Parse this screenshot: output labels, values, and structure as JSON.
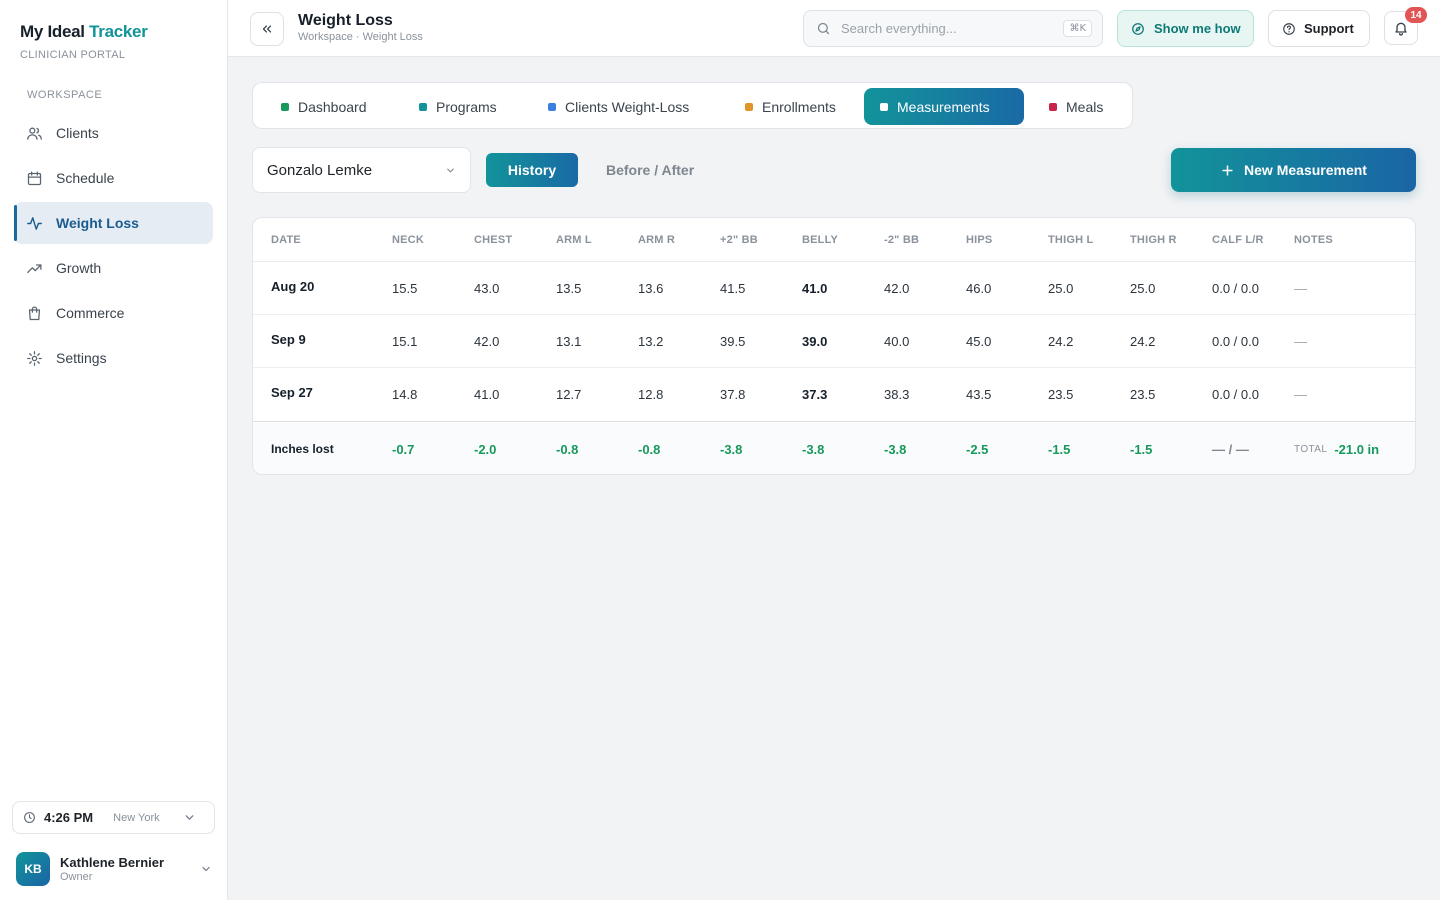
{
  "brand": {
    "name_part1": "My Ideal",
    "name_part2": "Tracker",
    "subtitle": "CLINICIAN PORTAL"
  },
  "sidebar": {
    "section_label": "WORKSPACE",
    "items": [
      {
        "label": "Clients",
        "icon": "users-icon"
      },
      {
        "label": "Schedule",
        "icon": "calendar-icon"
      },
      {
        "label": "Weight Loss",
        "icon": "activity-icon",
        "active": true
      },
      {
        "label": "Growth",
        "icon": "trending-up-icon"
      },
      {
        "label": "Commerce",
        "icon": "shopping-bag-icon"
      },
      {
        "label": "Settings",
        "icon": "gear-icon"
      }
    ],
    "clock": {
      "time": "4:26 PM",
      "timezone": "New York"
    },
    "user": {
      "initials": "KB",
      "name": "Kathlene Bernier",
      "role": "Owner"
    }
  },
  "topbar": {
    "title": "Weight Loss",
    "breadcrumb": "Workspace · Weight Loss",
    "search_placeholder": "Search everything...",
    "search_shortcut": "⌘K",
    "show_me_how": "Show me how",
    "support": "Support",
    "notifications_count": "14"
  },
  "tabs": [
    {
      "label": "Dashboard",
      "color": "#17995c"
    },
    {
      "label": "Programs",
      "color": "#12939a"
    },
    {
      "label": "Clients Weight-Loss",
      "color": "#3b7fe0"
    },
    {
      "label": "Enrollments",
      "color": "#e0952b"
    },
    {
      "label": "Measurements",
      "color": "#ffffff",
      "active": true
    },
    {
      "label": "Meals",
      "color": "#c8234a"
    }
  ],
  "controls": {
    "client": "Gonzalo Lemke",
    "history": "History",
    "before_after": "Before / After",
    "new_measurement": "New Measurement"
  },
  "table": {
    "headers": [
      "DATE",
      "NECK",
      "CHEST",
      "ARM L",
      "ARM R",
      "+2\" BB",
      "BELLY",
      "-2\" BB",
      "HIPS",
      "THIGH L",
      "THIGH R",
      "CALF L/R",
      "NOTES"
    ],
    "rows": [
      [
        "Aug 20",
        "15.5",
        "43.0",
        "13.5",
        "13.6",
        "41.5",
        "41.0",
        "42.0",
        "46.0",
        "25.0",
        "25.0",
        "0.0 / 0.0",
        "—"
      ],
      [
        "Sep 9",
        "15.1",
        "42.0",
        "13.1",
        "13.2",
        "39.5",
        "39.0",
        "40.0",
        "45.0",
        "24.2",
        "24.2",
        "0.0 / 0.0",
        "—"
      ],
      [
        "Sep 27",
        "14.8",
        "41.0",
        "12.7",
        "12.8",
        "37.8",
        "37.3",
        "38.3",
        "43.5",
        "23.5",
        "23.5",
        "0.0 / 0.0",
        "—"
      ]
    ],
    "footer": {
      "label": "Inches lost",
      "values": [
        "-0.7",
        "-2.0",
        "-0.8",
        "-0.8",
        "-3.8",
        "-3.8",
        "-3.8",
        "-2.5",
        "-1.5",
        "-1.5",
        "— / —"
      ],
      "total_label": "TOTAL",
      "total_value": "-21.0 in"
    }
  },
  "colors": {
    "accent_teal": "#12939a",
    "accent_blue": "#1a6aa5",
    "loss_green": "#17995c",
    "badge_red": "#e25555"
  }
}
